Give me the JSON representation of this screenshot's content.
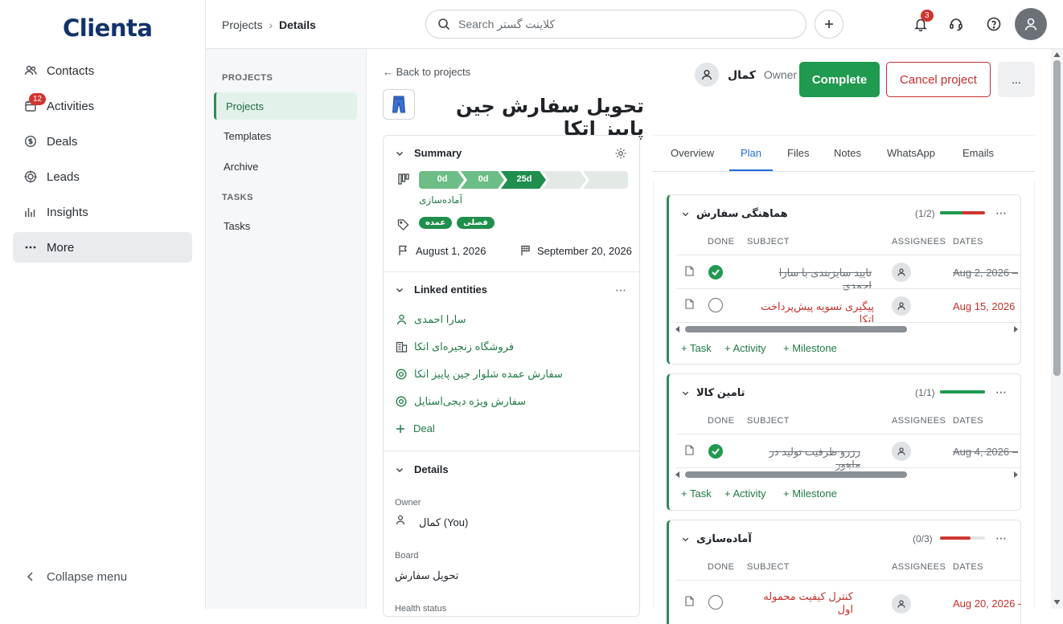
{
  "app": {
    "logo": "Clienta"
  },
  "sidebar": {
    "items": [
      {
        "label": "Contacts",
        "icon": "contacts-icon"
      },
      {
        "label": "Activities",
        "icon": "calendar-icon",
        "badge": "12"
      },
      {
        "label": "Deals",
        "icon": "dollar-icon"
      },
      {
        "label": "Leads",
        "icon": "target-icon"
      },
      {
        "label": "Insights",
        "icon": "chart-icon"
      },
      {
        "label": "More",
        "icon": "more-icon"
      }
    ],
    "collapse_label": "Collapse menu"
  },
  "header": {
    "breadcrumb_parent": "Projects",
    "breadcrumb_current": "Details",
    "search_placeholder": "Search کلاینت گستر",
    "notifications_count": "3"
  },
  "subnav": {
    "projects_heading": "PROJECTS",
    "projects_items": [
      "Projects",
      "Templates",
      "Archive"
    ],
    "tasks_heading": "TASKS",
    "tasks_items": [
      "Tasks"
    ]
  },
  "project": {
    "back_label": "← Back to projects",
    "title": "تحویل سفارش جین پاییز اتکا",
    "owner_name": "کمال",
    "owner_role": "Owner",
    "complete_label": "Complete",
    "cancel_label": "Cancel project",
    "more_label": "..."
  },
  "summary": {
    "heading": "Summary",
    "stages": [
      "0d",
      "0d",
      "25d",
      "",
      ""
    ],
    "stage_label": "آماده‌سازی",
    "tags": [
      "عمده",
      "فصلی"
    ],
    "start_date": "August 1, 2026",
    "end_date": "September 20, 2026"
  },
  "linked": {
    "heading": "Linked entities",
    "items": [
      {
        "label": "سارا احمدی",
        "icon": "person-icon"
      },
      {
        "label": "فروشگاه زنجیره‌ای اتکا",
        "icon": "building-icon"
      },
      {
        "label": "سفارش عمده شلوار جین پاییز اتکا",
        "icon": "target-icon"
      },
      {
        "label": "سفارش ویژه دیجی‌استایل",
        "icon": "target-icon"
      }
    ],
    "add_deal_label": "Deal"
  },
  "details": {
    "heading": "Details",
    "owner_label": "Owner",
    "owner_value": "کمال (You)",
    "board_label": "Board",
    "board_value": "تحویل سفارش",
    "health_label": "Health status"
  },
  "tabs": [
    "Overview",
    "Plan",
    "Files",
    "Notes",
    "WhatsApp",
    "Emails"
  ],
  "active_tab": "Plan",
  "columns": {
    "done": "DONE",
    "subject": "SUBJECT",
    "assignees": "ASSIGNEES",
    "dates": "DATES"
  },
  "add_links": {
    "task": "+ Task",
    "activity": "+ Activity",
    "milestone": "+ Milestone"
  },
  "milestones": [
    {
      "title": "هماهنگی سفارش",
      "count": "(1/2)",
      "progress_done": 0.5,
      "tasks": [
        {
          "subject": "تایید سایزبندی با سارا احمدی",
          "date": "Aug 2, 2026 – ",
          "done": true
        },
        {
          "subject": "پیگیری تسویه پیش‌پرداخت اتکا",
          "date": "Aug 15, 2026",
          "done": false
        }
      ]
    },
    {
      "title": "تامین کالا",
      "count": "(1/1)",
      "progress_done": 1.0,
      "tasks": [
        {
          "subject": "رزرو ظرفیت تولید در ماهور",
          "date": "Aug 4, 2026 – ",
          "done": true
        }
      ]
    },
    {
      "title": "آماده‌سازی",
      "count": "(0/3)",
      "progress_done": 0.0,
      "tasks": [
        {
          "subject": "کنترل کیفیت محموله اول",
          "date": "Aug 20, 2026 – ",
          "done": false
        }
      ]
    }
  ],
  "colors": {
    "accent": "#1f9a4f",
    "danger": "#c62f2a",
    "brand": "#12326b"
  }
}
